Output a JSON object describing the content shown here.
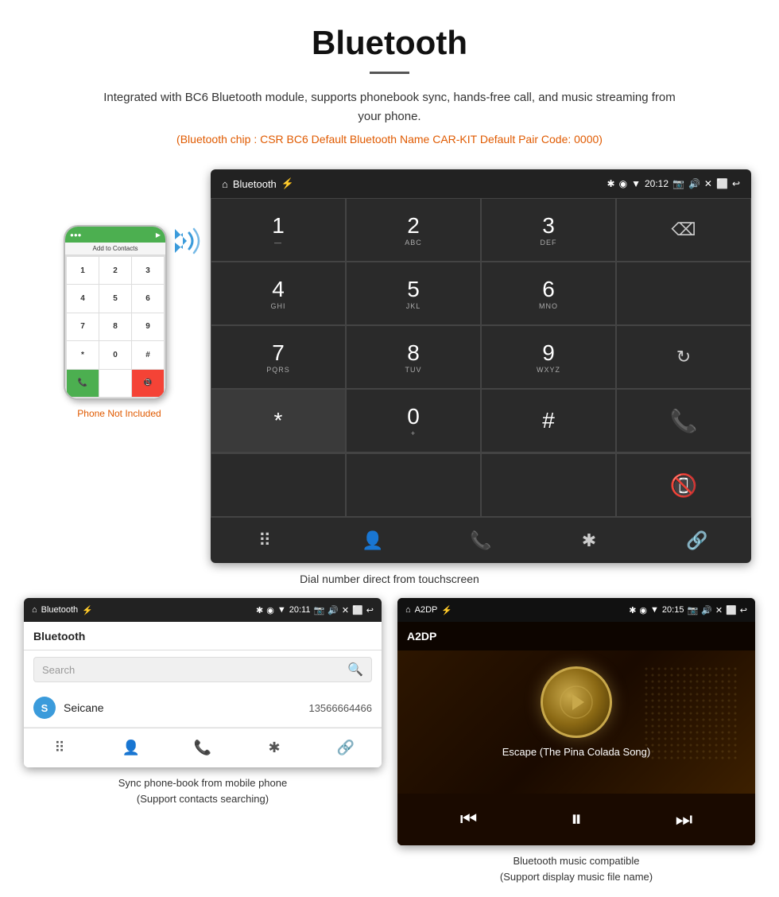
{
  "page": {
    "title": "Bluetooth",
    "description": "Integrated with BC6 Bluetooth module, supports phonebook sync, hands-free call, and music streaming from your phone.",
    "specs": "(Bluetooth chip : CSR BC6    Default Bluetooth Name CAR-KIT    Default Pair Code: 0000)",
    "dial_caption": "Dial number direct from touchscreen",
    "phonebook_caption": "Sync phone-book from mobile phone\n(Support contacts searching)",
    "music_caption": "Bluetooth music compatible\n(Support display music file name)"
  },
  "phone_not_included": "Phone Not Included",
  "status_bar": {
    "left_label": "Bluetooth",
    "time": "20:12"
  },
  "phonebook_status": {
    "left_label": "Bluetooth",
    "time": "20:11"
  },
  "music_status": {
    "left_label": "A2DP",
    "time": "20:15"
  },
  "dial_keys": [
    {
      "main": "1",
      "sub": ""
    },
    {
      "main": "2",
      "sub": "ABC"
    },
    {
      "main": "3",
      "sub": "DEF"
    },
    {
      "main": "",
      "sub": "BACKSPACE"
    },
    {
      "main": "4",
      "sub": "GHI"
    },
    {
      "main": "5",
      "sub": "JKL"
    },
    {
      "main": "6",
      "sub": "MNO"
    },
    {
      "main": "",
      "sub": "EMPTY"
    },
    {
      "main": "7",
      "sub": "PQRS"
    },
    {
      "main": "8",
      "sub": "TUV"
    },
    {
      "main": "9",
      "sub": "WXYZ"
    },
    {
      "main": "",
      "sub": "REFRESH"
    },
    {
      "main": "*",
      "sub": ""
    },
    {
      "main": "0",
      "sub": "+"
    },
    {
      "main": "#",
      "sub": ""
    },
    {
      "main": "",
      "sub": "CALL"
    },
    {
      "main": "",
      "sub": "ENDCALL"
    }
  ],
  "phonebook": {
    "search_placeholder": "Search",
    "contact_name": "Seicane",
    "contact_phone": "13566664466",
    "contact_letter": "S"
  },
  "music": {
    "song_title": "Escape (The Pina Colada Song)"
  }
}
